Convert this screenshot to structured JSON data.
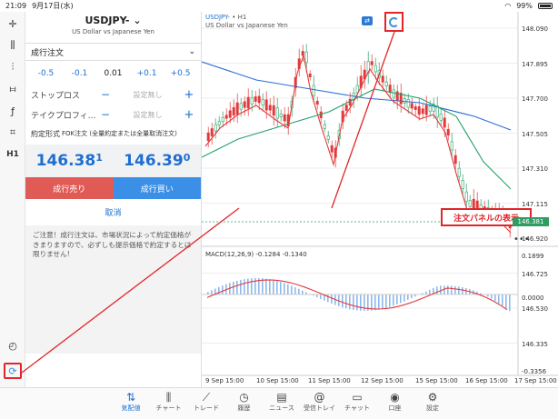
{
  "status_bar": {
    "time": "21:09",
    "date": "9月17日(水)",
    "battery": "99%"
  },
  "sidebar": {
    "items": [
      {
        "name": "crosshair-icon",
        "glyph": "✛"
      },
      {
        "name": "candle-type-icon",
        "glyph": "⫼"
      },
      {
        "name": "indicator-icon",
        "glyph": "⫶"
      },
      {
        "name": "settings-slider-icon",
        "glyph": "⧦"
      },
      {
        "name": "function-icon",
        "glyph": "ƒ"
      },
      {
        "name": "drawing-icon",
        "glyph": "⌗"
      },
      {
        "name": "timeframe-label",
        "glyph": "H1"
      }
    ],
    "bottom_items": [
      {
        "name": "analysis-icon",
        "glyph": "◴"
      },
      {
        "name": "order-panel-toggle-icon",
        "glyph": "⟳"
      }
    ]
  },
  "order_panel": {
    "symbol": "USDJPY-",
    "symbol_desc": "US Dollar vs Japanese Yen",
    "order_type": "成行注文",
    "qty_steps": [
      "-0.5",
      "-0.1",
      "0.01",
      "+0.1",
      "+0.5"
    ],
    "stop_loss_label": "ストップロス",
    "take_profit_label": "テイクプロフィ…",
    "unset": "設定無し",
    "execution_label": "約定形式",
    "execution_value": "FOK注文 (全量約定または全量取消注文)",
    "bid_main": "146.38",
    "bid_sup": "1",
    "ask_main": "146.39",
    "ask_sup": "0",
    "sell_label": "成行売り",
    "buy_label": "成行買い",
    "cancel_label": "取消",
    "notice": "ご注意！成行注文は、市場状況によって約定価格がきまりますので、必ずしも提示価格で約定するとは限りません!"
  },
  "chart": {
    "symbol": "USDJPY-",
    "timeframe": "• H1",
    "symbol_desc": "US Dollar vs Japanese Yen",
    "callout": "注文パネルの表示",
    "current_price": "146.381",
    "price_axis": [
      "148.090",
      "147.895",
      "147.700",
      "147.505",
      "147.310",
      "147.115",
      "146.920",
      "146.725",
      "146.530",
      "146.335"
    ],
    "macd_label": "MACD(12,26,9) -0.1284 -0.1340",
    "macd_axis": [
      "0.1899",
      "0.0000",
      "-0.3356"
    ],
    "x_labels": [
      "9 Sep 15:00",
      "10 Sep 15:00",
      "11 Sep 15:00",
      "12 Sep 15:00",
      "15 Sep 15:00",
      "16 Sep 15:00",
      "17 Sep 15:00"
    ],
    "colors": {
      "bull": "#27a06a",
      "bear": "#e23a3a",
      "ma_slow": "#2b6fd6",
      "ma_mid": "#27a06a",
      "ma_fast": "#e23a3a",
      "highlight": "#e0262a"
    }
  },
  "bottom_nav": [
    {
      "label": "気配値",
      "glyph": "⇅",
      "active": true
    },
    {
      "label": "チャート",
      "glyph": "⫼",
      "active": false
    },
    {
      "label": "トレード",
      "glyph": "⟋",
      "active": false
    },
    {
      "label": "履歴",
      "glyph": "◷",
      "active": false
    },
    {
      "label": "ニュース",
      "glyph": "▤",
      "active": false
    },
    {
      "label": "受信トレイ",
      "glyph": "@",
      "active": false
    },
    {
      "label": "チャット",
      "glyph": "▭",
      "active": false
    },
    {
      "label": "口座",
      "glyph": "◉",
      "active": false
    },
    {
      "label": "設定",
      "glyph": "⚙",
      "active": false
    }
  ]
}
